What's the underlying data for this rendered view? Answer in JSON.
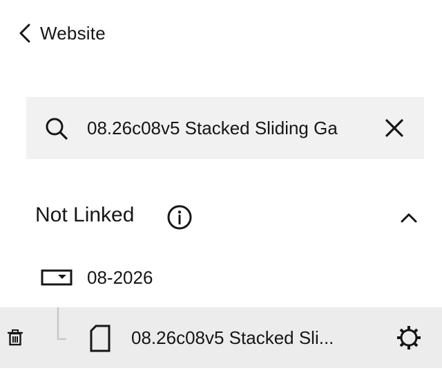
{
  "nav": {
    "back_label": "Website",
    "back_icon": "chevron-left-icon"
  },
  "search": {
    "value": "08.26c08v5 Stacked Sliding Ga",
    "placeholder": "Search",
    "search_icon": "search-icon",
    "clear_icon": "close-icon"
  },
  "section": {
    "title": "Not Linked",
    "info_icon": "info-icon",
    "collapse_icon": "chevron-up-icon"
  },
  "folder": {
    "name": "08-2026",
    "icon": "folder-icon"
  },
  "page_item": {
    "name": "08.26c08v5 Stacked Sli...",
    "icon": "page-icon",
    "delete_icon": "trash-icon",
    "settings_icon": "gear-icon"
  },
  "colors": {
    "search_background": "#f1f1f1",
    "row_highlight": "#ececec",
    "text": "#161616",
    "tree_line": "#c8c8c8"
  }
}
